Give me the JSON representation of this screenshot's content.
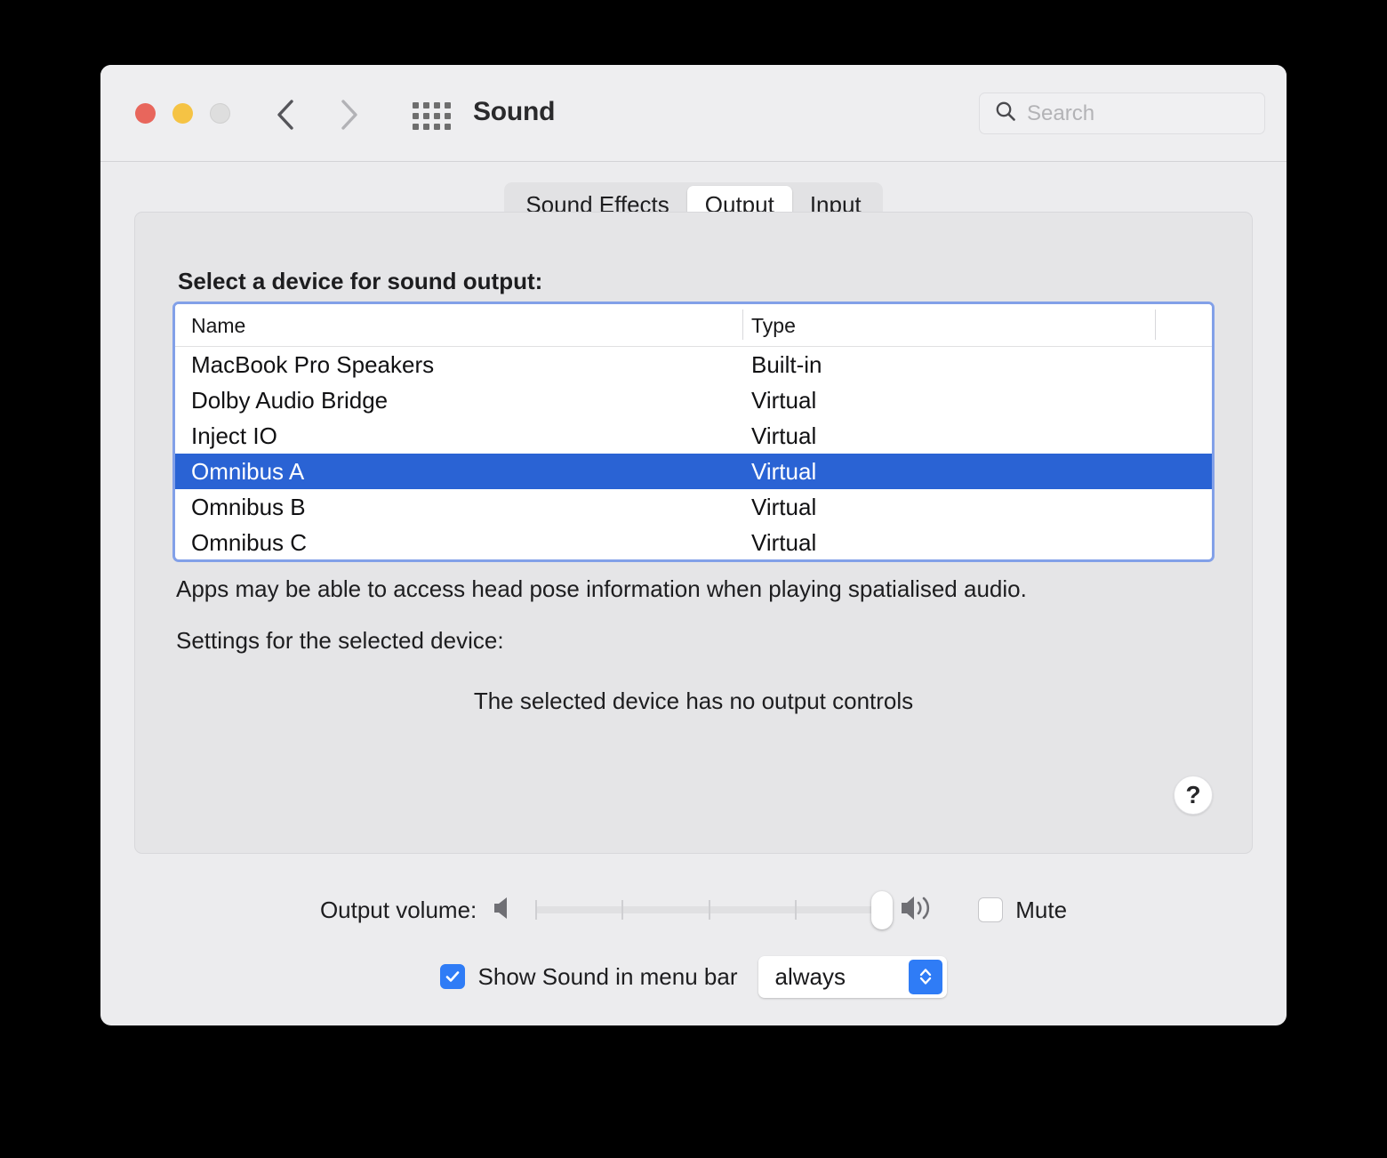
{
  "window": {
    "title": "Sound",
    "traffic_lights": [
      {
        "name": "close",
        "color": "#e8665c"
      },
      {
        "name": "minimize",
        "color": "#f5c344"
      },
      {
        "name": "zoom",
        "color": "#dedede"
      }
    ],
    "nav": {
      "back_icon": "chevron-left-icon",
      "forward_icon": "chevron-right-icon",
      "grid_icon": "show-all-grid-icon"
    },
    "search": {
      "icon": "search-icon",
      "placeholder": "Search",
      "value": ""
    }
  },
  "tabs": [
    {
      "label": "Sound Effects",
      "selected": false
    },
    {
      "label": "Output",
      "selected": true
    },
    {
      "label": "Input",
      "selected": false
    }
  ],
  "output_pane": {
    "section_title": "Select a device for sound output:",
    "table": {
      "columns": [
        "Name",
        "Type"
      ],
      "rows": [
        {
          "name": "MacBook Pro Speakers",
          "type": "Built-in",
          "selected": false
        },
        {
          "name": "Dolby Audio Bridge",
          "type": "Virtual",
          "selected": false
        },
        {
          "name": "Inject IO",
          "type": "Virtual",
          "selected": false
        },
        {
          "name": "Omnibus A",
          "type": "Virtual",
          "selected": true
        },
        {
          "name": "Omnibus B",
          "type": "Virtual",
          "selected": false
        },
        {
          "name": "Omnibus C",
          "type": "Virtual",
          "selected": false
        }
      ],
      "selection_color": "#2a63d4",
      "focus_ring_color": "#82a0e8"
    },
    "spatial_note": "Apps may be able to access head pose information when playing spatialised audio.",
    "settings_label": "Settings for the selected device:",
    "no_controls_message": "The selected device has no output controls",
    "help_label": "?"
  },
  "volume": {
    "label": "Output volume:",
    "min_icon": "speaker-low-icon",
    "max_icon": "speaker-high-icon",
    "value": 100,
    "tick_count": 5,
    "mute": {
      "label": "Mute",
      "checked": false
    }
  },
  "menu_bar": {
    "checkbox_checked": true,
    "label": "Show Sound in menu bar",
    "popup_value": "always",
    "popup_icon": "chevron-up-down-icon"
  }
}
